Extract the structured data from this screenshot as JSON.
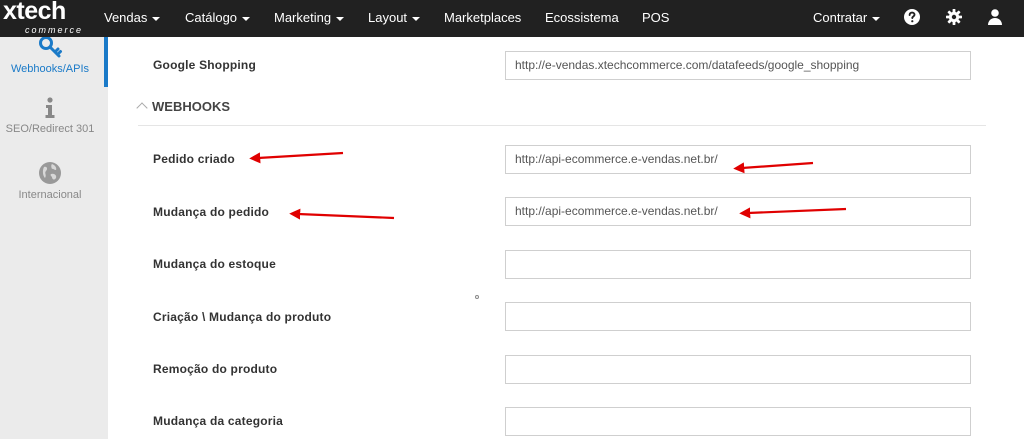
{
  "brand": {
    "name": "xtech",
    "tagline": "commerce"
  },
  "topnav": {
    "items": [
      {
        "label": "Vendas",
        "dropdown": true
      },
      {
        "label": "Catálogo",
        "dropdown": true
      },
      {
        "label": "Marketing",
        "dropdown": true
      },
      {
        "label": "Layout",
        "dropdown": true
      },
      {
        "label": "Marketplaces",
        "dropdown": false
      },
      {
        "label": "Ecossistema",
        "dropdown": false
      },
      {
        "label": "POS",
        "dropdown": false
      }
    ],
    "contratar": "Contratar",
    "icons": [
      "help-icon",
      "gear-icon",
      "user-icon"
    ]
  },
  "sidebar": {
    "items": [
      {
        "label": "Webhooks/APIs",
        "icon": "key-icon",
        "active": true
      },
      {
        "label": "SEO/Redirect 301",
        "icon": "info-icon",
        "active": false
      },
      {
        "label": "Internacional",
        "icon": "globe-icon",
        "active": false
      }
    ]
  },
  "form": {
    "google_shopping": {
      "label": "Google Shopping",
      "value": "http://e-vendas.xtechcommerce.com/datafeeds/google_shopping"
    },
    "section_title": "WEBHOOKS",
    "webhooks": [
      {
        "label": "Pedido criado",
        "value": "http://api-ecommerce.e-vendas.net.br/"
      },
      {
        "label": "Mudança do pedido",
        "value": "http://api-ecommerce.e-vendas.net.br/"
      },
      {
        "label": "Mudança do estoque",
        "value": ""
      },
      {
        "label": "Criação \\ Mudança do produto",
        "value": ""
      },
      {
        "label": "Remoção do produto",
        "value": ""
      },
      {
        "label": "Mudança da categoria",
        "value": ""
      }
    ]
  },
  "colors": {
    "topbar": "#212121",
    "accent": "#1a7ac8",
    "annotation_arrow": "#e00000"
  }
}
